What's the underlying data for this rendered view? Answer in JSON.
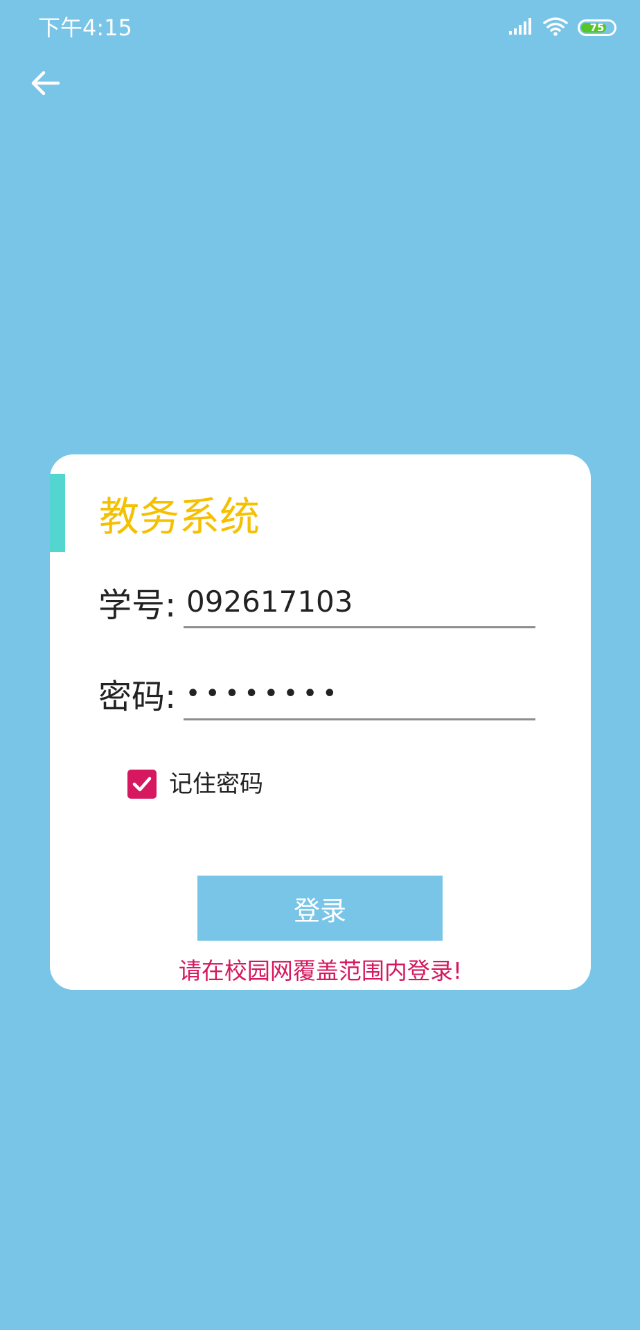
{
  "status_bar": {
    "time": "下午4:15",
    "battery_level": "75",
    "icons": [
      "signal-icon",
      "wifi-icon",
      "battery-icon"
    ]
  },
  "nav": {
    "back_icon": "arrow-left-icon"
  },
  "login_card": {
    "title": "教务系统",
    "student_id_label": "学号:",
    "student_id_value": "092617103",
    "password_label": "密码:",
    "password_value": "••••••••",
    "remember_label": "记住密码",
    "remember_checked": true,
    "login_button_label": "登录",
    "hint": "请在校园网覆盖范围内登录!"
  },
  "colors": {
    "background": "#78c5e7",
    "card": "#ffffff",
    "title": "#f5c000",
    "accent_bar": "#53d6d0",
    "checkbox": "#d5185f",
    "hint": "#d5185f",
    "button": "#78c5e7"
  }
}
